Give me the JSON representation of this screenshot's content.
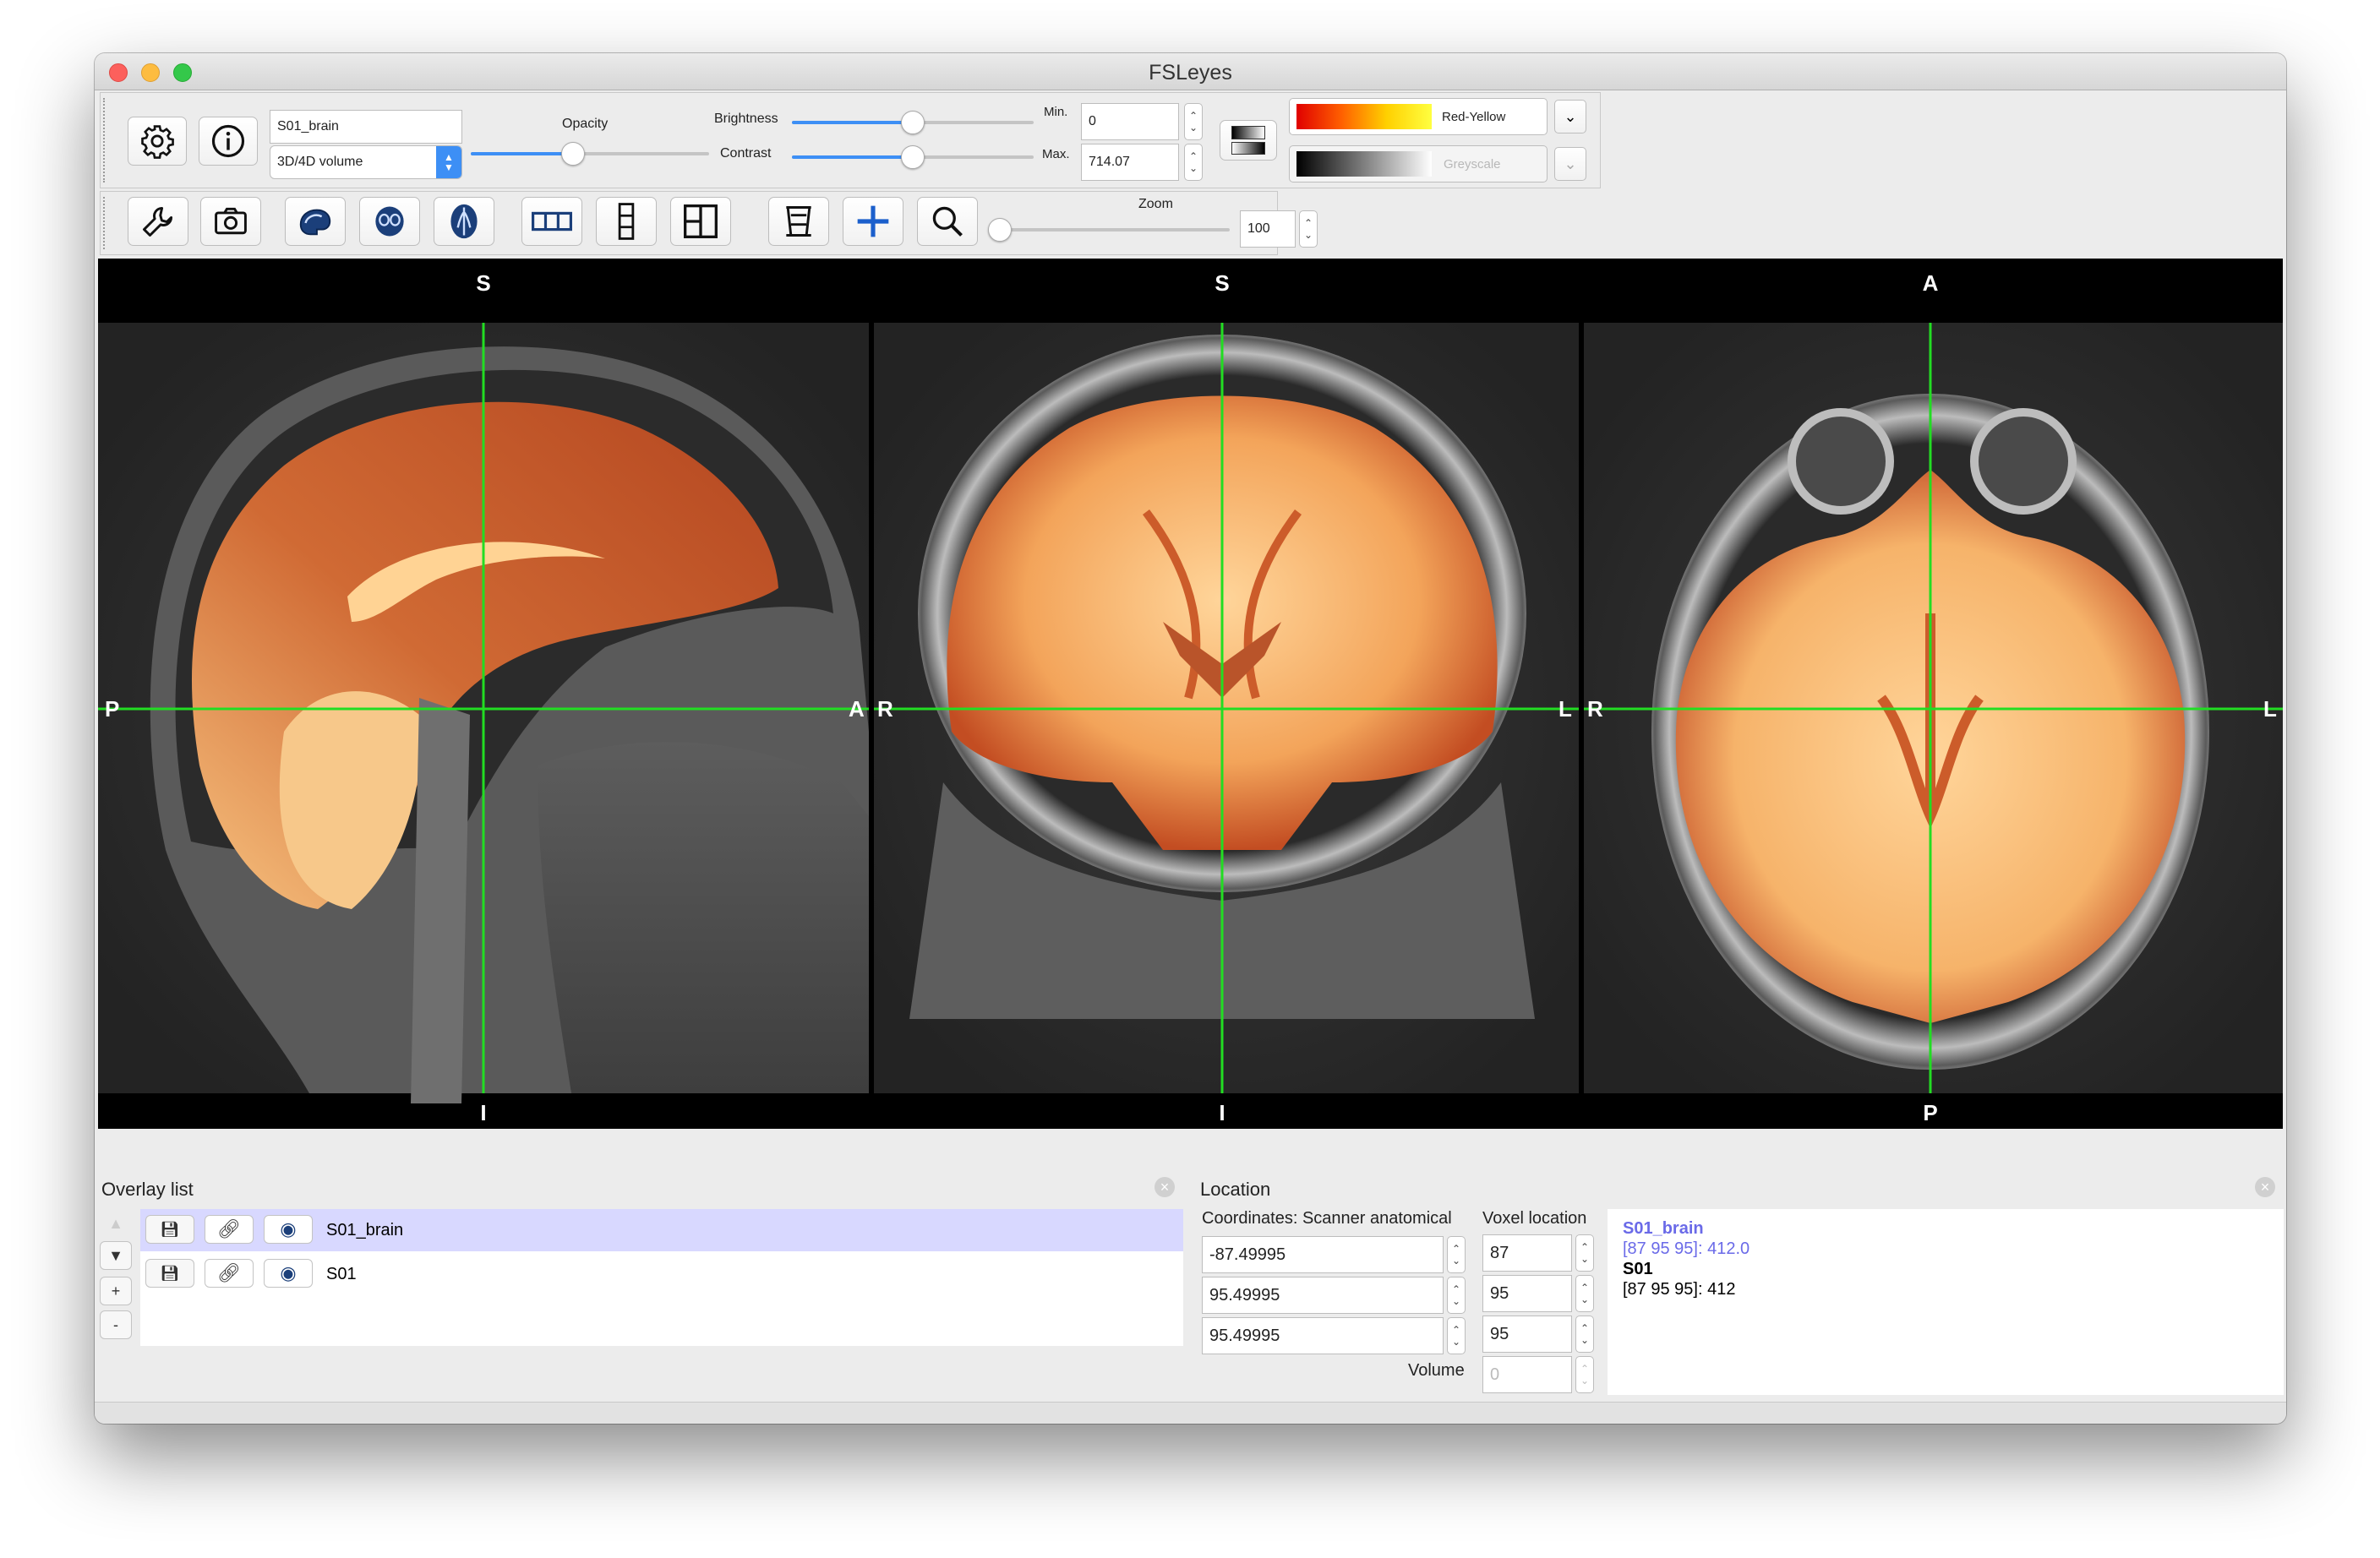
{
  "window": {
    "title": "FSLeyes"
  },
  "overlay_toolbar": {
    "overlay_name": "S01_brain",
    "overlay_type": "3D/4D volume",
    "opacity_label": "Opacity",
    "opacity": 0.43,
    "brightness_label": "Brightness",
    "brightness": 0.5,
    "contrast_label": "Contrast",
    "contrast": 0.5,
    "min_label": "Min.",
    "min_value": "0",
    "max_label": "Max.",
    "max_value": "714.07",
    "colormap": "Red-Yellow",
    "neg_colormap": "Greyscale",
    "icons": [
      "gear-icon",
      "info-icon",
      "colorbar-toggle-icon",
      "chevron-down-icon"
    ]
  },
  "ortho_toolbar": {
    "zoom_label": "Zoom",
    "zoom_value": "100",
    "zoom": 0.0,
    "icons": [
      "wrench-icon",
      "camera-icon",
      "sagittal-icon",
      "coronal-icon",
      "axial-icon",
      "horizontal-layout-icon",
      "vertical-layout-icon",
      "grid-layout-icon",
      "movie-icon",
      "crosshair-icon",
      "magnify-icon"
    ]
  },
  "canvas": {
    "sagittal": {
      "top": "S",
      "bottom": "I",
      "left": "P",
      "right": "A"
    },
    "coronal": {
      "top": "S",
      "bottom": "I",
      "left": "R",
      "right": "L"
    },
    "axial": {
      "top": "A",
      "bottom": "P",
      "left": "R",
      "right": "L"
    },
    "crosshair_color": "#22dd22",
    "overlay_colors": {
      "dark": "#b8431f",
      "mid": "#e8863f",
      "light": "#ffd394"
    }
  },
  "overlay_list": {
    "title": "Overlay list",
    "items": [
      {
        "name": "S01_brain",
        "selected": true
      },
      {
        "name": "S01",
        "selected": false
      }
    ],
    "controls": {
      "up": "▲",
      "down": "▼",
      "add": "+",
      "remove": "-"
    }
  },
  "location": {
    "title": "Location",
    "coords_label": "Coordinates: Scanner anatomical",
    "voxel_label": "Voxel location",
    "coords": [
      "-87.49995",
      "95.49995",
      "95.49995"
    ],
    "voxels": [
      "87",
      "95",
      "95"
    ],
    "volume_label": "Volume",
    "volume_value": "0",
    "info": [
      {
        "name": "S01_brain",
        "value": "[87 95 95]: 412.0",
        "color": "#6a6ae8"
      },
      {
        "name": "S01",
        "value": "[87 95 95]: 412",
        "color": "#000000"
      }
    ]
  }
}
